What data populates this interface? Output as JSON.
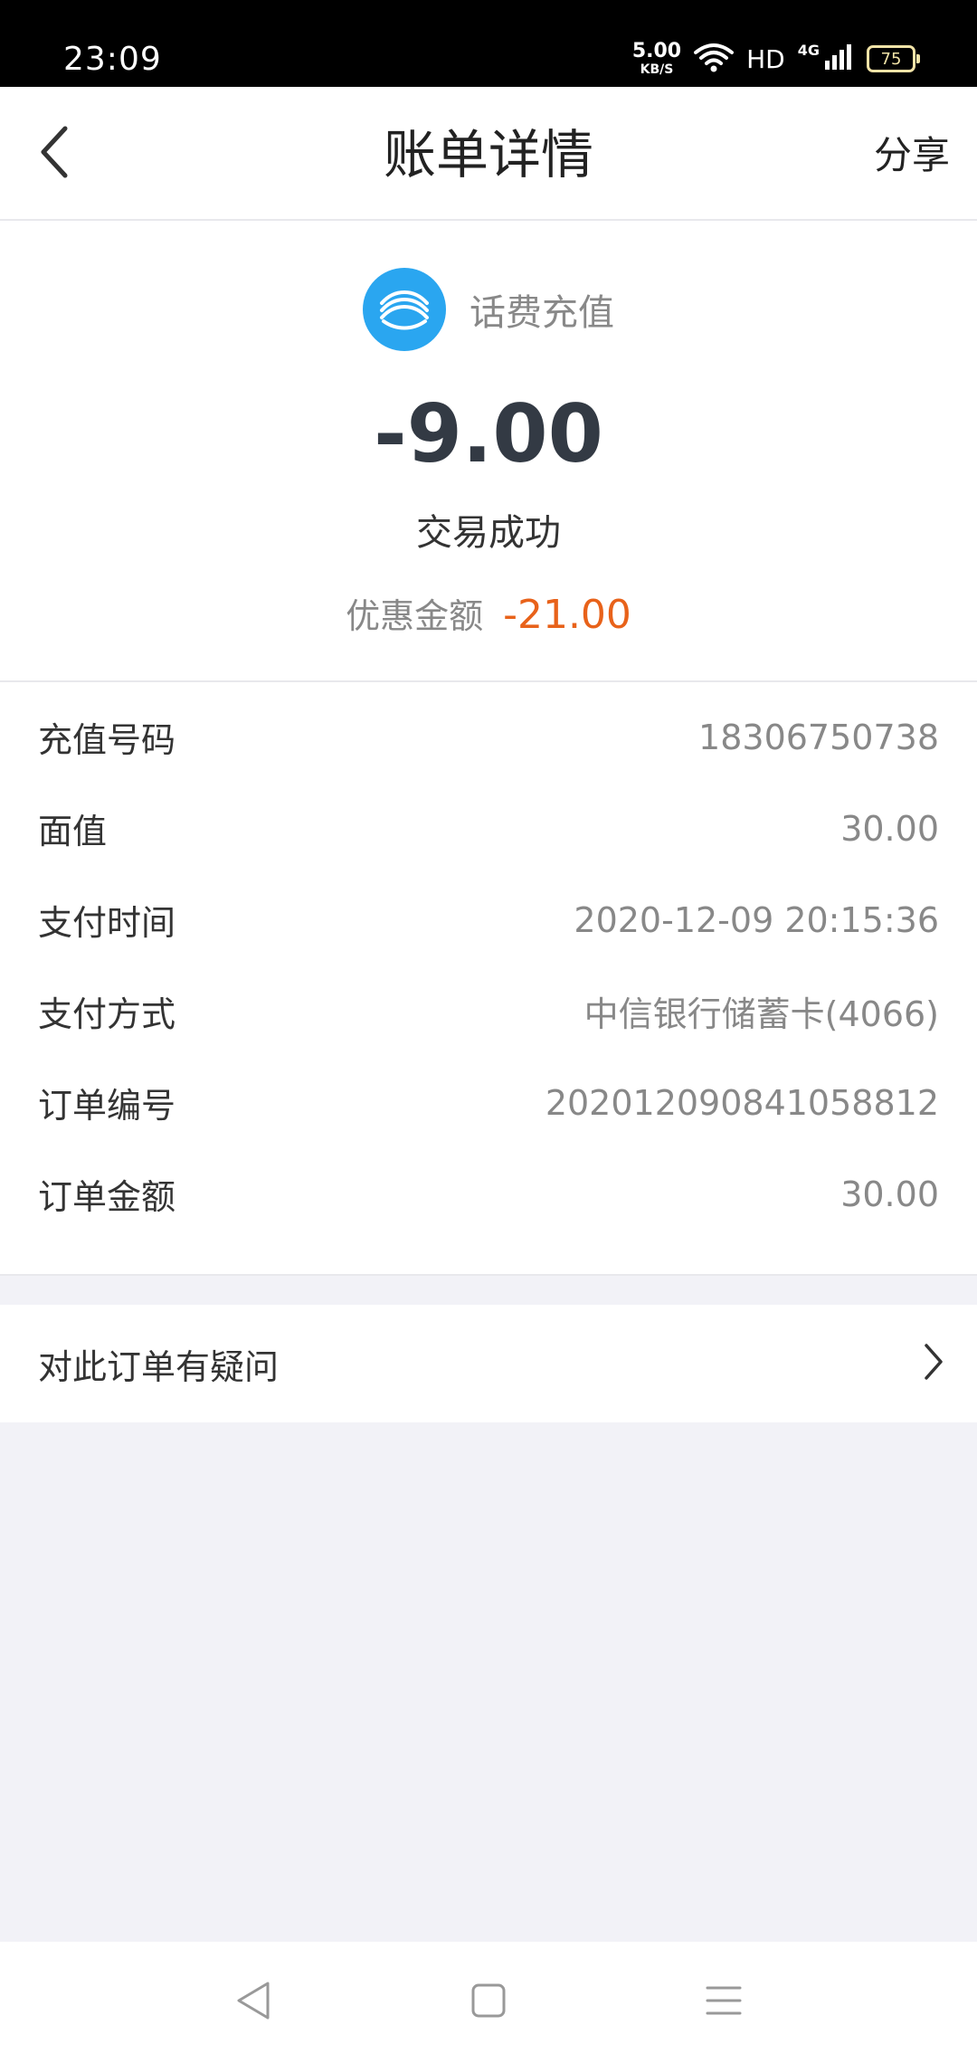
{
  "status_bar": {
    "time": "23:09",
    "net_speed": "5.00",
    "net_speed_unit": "KB/S",
    "hd": "HD",
    "network": "4G",
    "battery": "75"
  },
  "nav": {
    "title": "账单详情",
    "share": "分享"
  },
  "summary": {
    "merchant_name": "话费充值",
    "amount": "-9.00",
    "status": "交易成功",
    "discount_label": "优惠金额",
    "discount_value": "-21.00"
  },
  "details": [
    {
      "label": "充值号码",
      "value": "18306750738"
    },
    {
      "label": "面值",
      "value": "30.00"
    },
    {
      "label": "支付时间",
      "value": "2020-12-09 20:15:36"
    },
    {
      "label": "支付方式",
      "value": "中信银行储蓄卡(4066)"
    },
    {
      "label": "订单编号",
      "value": "202012090841058812"
    },
    {
      "label": "订单金额",
      "value": "30.00"
    }
  ],
  "question": {
    "label": "对此订单有疑问"
  },
  "icons": {
    "back": "chevron-left-icon",
    "merchant_logo": "china-mobile-logo",
    "question_arrow": "chevron-right-icon",
    "sys_back": "triangle-back-icon",
    "sys_home": "square-home-icon",
    "sys_menu": "menu-icon"
  },
  "colors": {
    "accent_discount": "#e8621a",
    "logo_blue": "#2aa6f0"
  }
}
